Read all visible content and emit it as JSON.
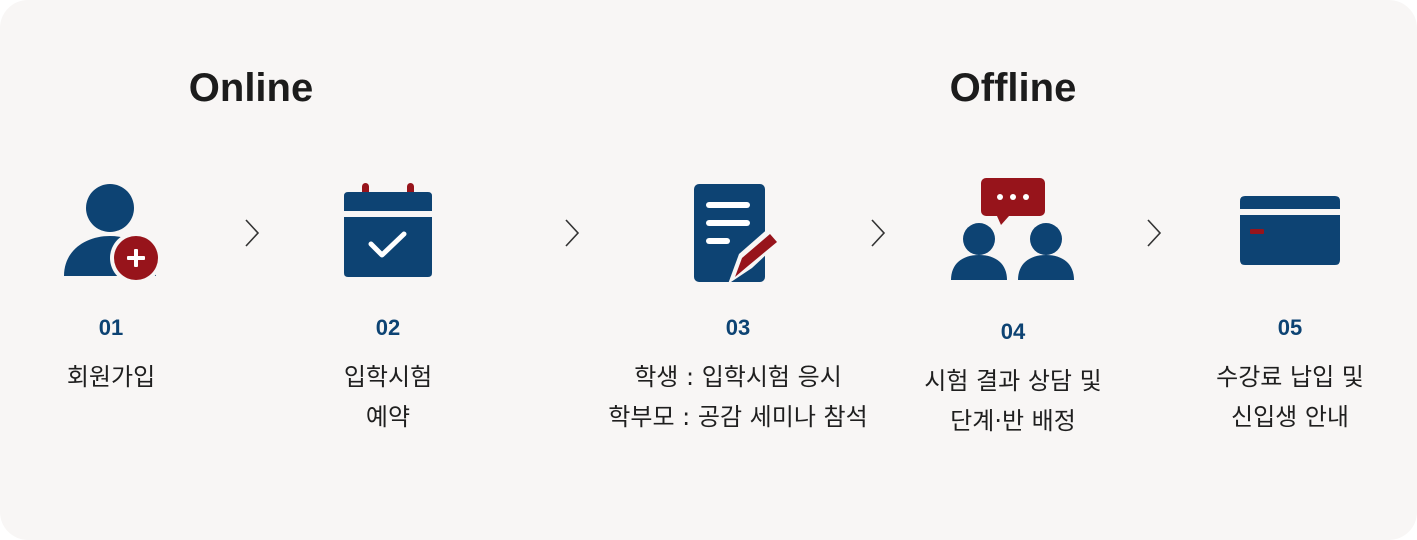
{
  "headings": {
    "online": "Online",
    "offline": "Offline"
  },
  "steps": [
    {
      "num": "01",
      "lines": [
        "회원가입"
      ],
      "icon": "user-add-icon"
    },
    {
      "num": "02",
      "lines": [
        "입학시험",
        "예약"
      ],
      "icon": "calendar-check-icon"
    },
    {
      "num": "03",
      "lines": [
        "학생 : 입학시험 응시",
        "학부모 : 공감 세미나 참석"
      ],
      "icon": "document-edit-icon"
    },
    {
      "num": "04",
      "lines": [
        "시험 결과 상담 및",
        "단계·반 배정"
      ],
      "icon": "consultation-icon"
    },
    {
      "num": "05",
      "lines": [
        "수강료 납입 및",
        "신입생 안내"
      ],
      "icon": "credit-card-icon"
    }
  ],
  "colors": {
    "navy": "#0d4373",
    "red": "#97141b",
    "background": "#f8f6f5"
  }
}
